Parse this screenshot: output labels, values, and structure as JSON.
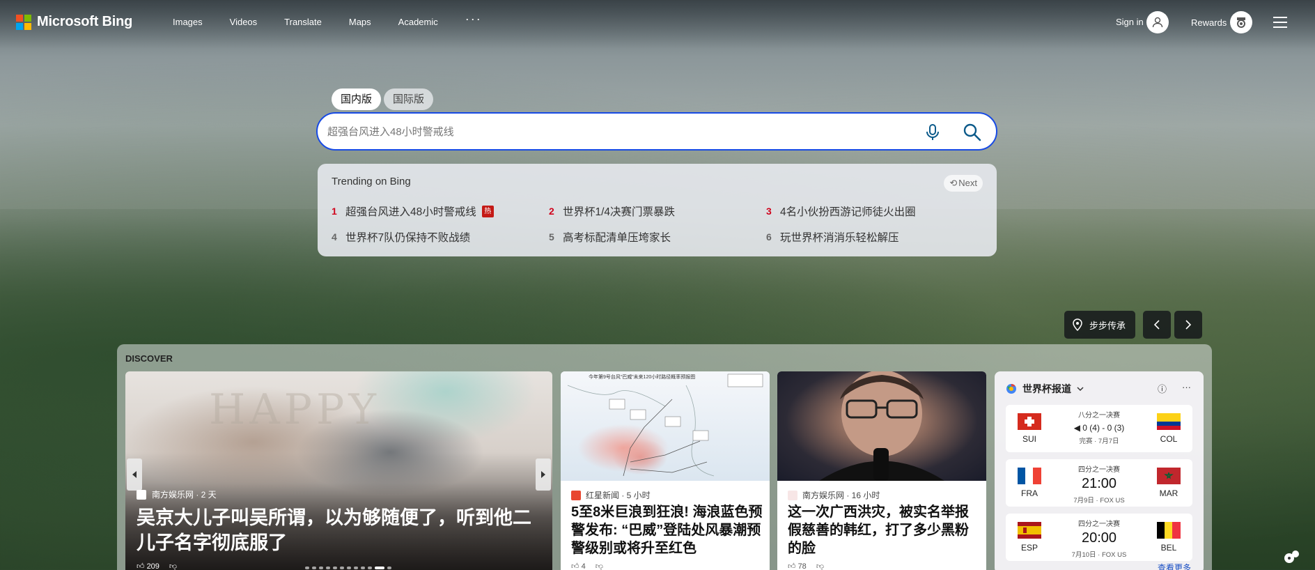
{
  "header": {
    "logo_text": "Microsoft Bing",
    "nav": [
      "Images",
      "Videos",
      "Translate",
      "Maps",
      "Academic"
    ],
    "more": "···",
    "signin": "Sign in",
    "rewards": "Rewards"
  },
  "search": {
    "tabs": [
      "国内版",
      "国际版"
    ],
    "placeholder": "超强台风进入48小时警戒线"
  },
  "trending": {
    "title": "Trending on Bing",
    "next": "Next",
    "items": [
      {
        "num": "1",
        "text": "超强台风进入48小时警戒线",
        "badge": "热"
      },
      {
        "num": "2",
        "text": "世界杯1/4决赛门票暴跌"
      },
      {
        "num": "3",
        "text": "4名小伙扮西游记师徒火出圈"
      },
      {
        "num": "4",
        "text": "世界杯7队仍保持不败战绩"
      },
      {
        "num": "5",
        "text": "高考标配清单压垮家长"
      },
      {
        "num": "6",
        "text": "玩世界杯消消乐轻松解压"
      }
    ]
  },
  "location": {
    "label": "步步传承"
  },
  "discover": {
    "label": "DISCOVER",
    "hero": {
      "source": "南方娱乐网 · 2 天",
      "title": "吴京大儿子叫吴所谓，以为够随便了，听到他二儿子名字彻底服了",
      "likes": "209",
      "photo_text": "HAPPY"
    },
    "cards": [
      {
        "source": "红星新闻 · 5 小时",
        "title": "5至8米巨浪到狂浪! 海浪蓝色预警发布: “巴威”登陆处风暴潮预警级别或将升至红色",
        "likes": "4",
        "caption": "今年第9号台风“巴威”未来120小时路径概率预报图"
      },
      {
        "source": "南方娱乐网 · 16 小时",
        "title": "这一次广西洪灾，被实名举报假慈善的韩红，打了多少黑粉的脸",
        "likes": "78"
      }
    ]
  },
  "worldcup": {
    "title": "世界杯报道",
    "matches": [
      {
        "home": "SUI",
        "away": "COL",
        "stage": "八分之一决赛",
        "score": "◀ 0 (4) - 0 (3)",
        "meta": "完赛 · 7月7日"
      },
      {
        "home": "FRA",
        "away": "MAR",
        "stage": "四分之一决赛",
        "time": "21:00",
        "meta": "7月9日 · FOX US"
      },
      {
        "home": "ESP",
        "away": "BEL",
        "stage": "四分之一决赛",
        "time": "20:00",
        "meta": "7月10日 · FOX US"
      }
    ],
    "more": "查看更多"
  },
  "colors": {
    "accent": "#174ae4",
    "hot": "#d0021b",
    "ms_red": "#f25022",
    "ms_green": "#7fba00",
    "ms_blue": "#00a4ef",
    "ms_yellow": "#ffb900"
  }
}
